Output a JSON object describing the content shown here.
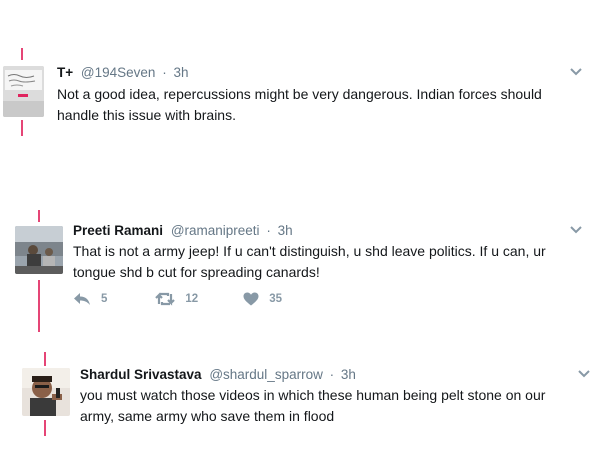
{
  "tweets": [
    {
      "name": "T+",
      "handle": "@194Seven",
      "separator": "·",
      "time": "3h",
      "text_line1": "Not a good idea, repercussions might be very dangerous. Indian forces should",
      "text_line2": "handle this issue with brains.",
      "avatar": "sketch-image-avatar"
    },
    {
      "name": "Preeti Ramani",
      "handle": "@ramanipreeti",
      "separator": "·",
      "time": "3h",
      "text_line1": "That is not a army jeep! If u can't distinguish, u shd leave politics. If u can, ur",
      "text_line2": "tongue shd b cut for spreading canards!",
      "avatar": "photo-avatar",
      "actions": {
        "reply_count": "5",
        "retweet_count": "12",
        "like_count": "35"
      }
    },
    {
      "name": "Shardul Srivastava",
      "handle": "@shardul_sparrow",
      "separator": "·",
      "time": "3h",
      "text_line1": "you must watch those videos in which these human being pelt stone on our",
      "text_line2": "army, same army who save them in flood",
      "avatar": "selfie-avatar"
    }
  ],
  "colors": {
    "thread_line": "#e0245e",
    "text": "#14171a",
    "muted": "#657786",
    "action": "#8899a6"
  }
}
